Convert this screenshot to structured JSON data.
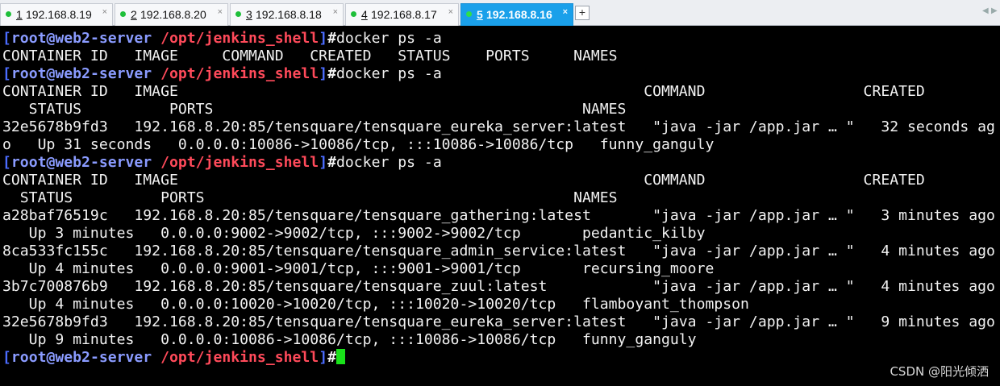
{
  "tabs": [
    {
      "num": "1",
      "host": "192.168.8.19",
      "active": false
    },
    {
      "num": "2",
      "host": "192.168.8.20",
      "active": false
    },
    {
      "num": "3",
      "host": "192.168.8.18",
      "active": false
    },
    {
      "num": "4",
      "host": "192.168.8.17",
      "active": false
    },
    {
      "num": "5",
      "host": "192.168.8.16",
      "active": true
    }
  ],
  "tab_close_glyph": "×",
  "tab_add_glyph": "+",
  "tab_scroll_left": "◀",
  "tab_scroll_right": "▶",
  "prompt": {
    "open": "[",
    "user_host": "root@web2-server",
    "path": " /opt/jenkins_shell",
    "close": "]",
    "hash": "#"
  },
  "command": "docker ps -a",
  "output": {
    "block1": [
      "CONTAINER ID   IMAGE     COMMAND   CREATED   STATUS    PORTS     NAMES"
    ],
    "block2": [
      "CONTAINER ID   IMAGE                                                     COMMAND                  CREATED",
      "   STATUS          PORTS                                          NAMES",
      "32e5678b9fd3   192.168.8.20:85/tensquare/tensquare_eureka_server:latest   \"java -jar /app.jar … \"   32 seconds ag",
      "o   Up 31 seconds   0.0.0.0:10086->10086/tcp, :::10086->10086/tcp   funny_ganguly"
    ],
    "block3": [
      "CONTAINER ID   IMAGE                                                     COMMAND                  CREATED",
      "  STATUS          PORTS                                          NAMES",
      "a28baf76519c   192.168.8.20:85/tensquare/tensquare_gathering:latest       \"java -jar /app.jar … \"   3 minutes ago",
      "   Up 3 minutes   0.0.0.0:9002->9002/tcp, :::9002->9002/tcp       pedantic_kilby",
      "8ca533fc155c   192.168.8.20:85/tensquare/tensquare_admin_service:latest   \"java -jar /app.jar … \"   4 minutes ago",
      "   Up 4 minutes   0.0.0.0:9001->9001/tcp, :::9001->9001/tcp       recursing_moore",
      "3b7c700876b9   192.168.8.20:85/tensquare/tensquare_zuul:latest            \"java -jar /app.jar … \"   4 minutes ago",
      "   Up 4 minutes   0.0.0.0:10020->10020/tcp, :::10020->10020/tcp   flamboyant_thompson",
      "32e5678b9fd3   192.168.8.20:85/tensquare/tensquare_eureka_server:latest   \"java -jar /app.jar … \"   9 minutes ago",
      "   Up 9 minutes   0.0.0.0:10086->10086/tcp, :::10086->10086/tcp   funny_ganguly"
    ]
  },
  "watermark": "CSDN @阳光倾洒",
  "colors": {
    "background": "#000000",
    "foreground": "#f2f2f2",
    "prompt_bracket": "#4b6cff",
    "prompt_user": "#8a9bff",
    "prompt_path": "#ff4a5a",
    "cursor": "#19e21a",
    "active_tab": "#1aa0ea"
  }
}
